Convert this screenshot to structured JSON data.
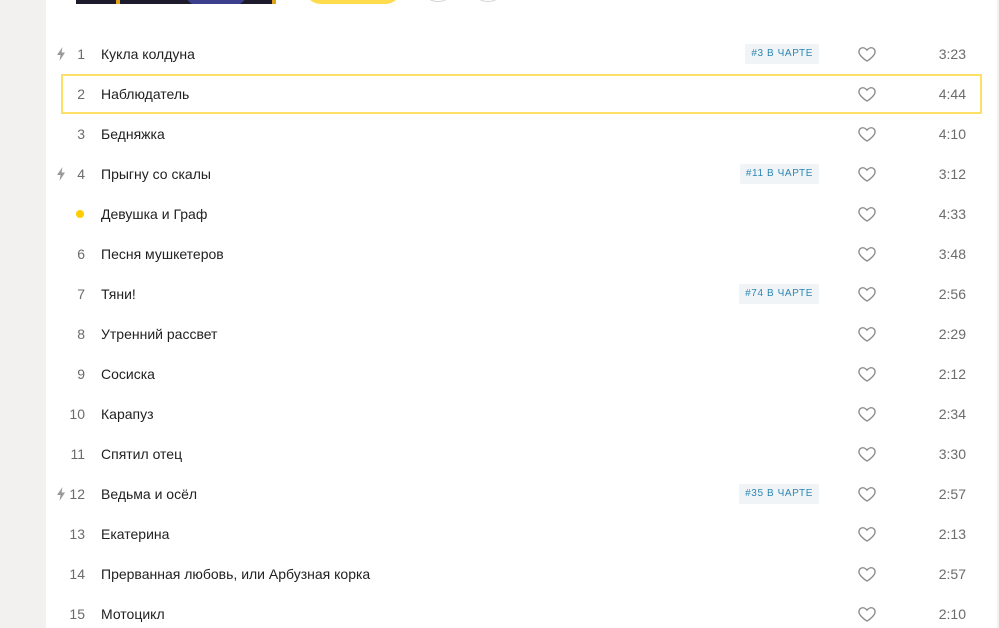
{
  "colors": {
    "accent": "#ffdb4d",
    "selection_border": "#ffe066",
    "playing_dot": "#ffcc00",
    "chart_badge_text": "#2c86b5",
    "chart_badge_bg": "#f0f4f6"
  },
  "tracks": [
    {
      "num": "1",
      "title": "Кукла колдуна",
      "chart": "#3 В ЧАРТЕ",
      "duration": "3:23",
      "bolt": true
    },
    {
      "num": "2",
      "title": "Наблюдатель",
      "chart": "",
      "duration": "4:44",
      "bolt": false,
      "selected": true
    },
    {
      "num": "3",
      "title": "Бедняжка",
      "chart": "",
      "duration": "4:10",
      "bolt": false
    },
    {
      "num": "4",
      "title": "Прыгну со скалы",
      "chart": "#11 В ЧАРТЕ",
      "duration": "3:12",
      "bolt": true
    },
    {
      "num": "",
      "title": "Девушка и Граф",
      "chart": "",
      "duration": "4:33",
      "bolt": false,
      "playing": true
    },
    {
      "num": "6",
      "title": "Песня мушкетеров",
      "chart": "",
      "duration": "3:48",
      "bolt": false
    },
    {
      "num": "7",
      "title": "Тяни!",
      "chart": "#74 В ЧАРТЕ",
      "duration": "2:56",
      "bolt": false
    },
    {
      "num": "8",
      "title": "Утренний рассвет",
      "chart": "",
      "duration": "2:29",
      "bolt": false
    },
    {
      "num": "9",
      "title": "Сосиска",
      "chart": "",
      "duration": "2:12",
      "bolt": false
    },
    {
      "num": "10",
      "title": "Карапуз",
      "chart": "",
      "duration": "2:34",
      "bolt": false
    },
    {
      "num": "11",
      "title": "Спятил отец",
      "chart": "",
      "duration": "3:30",
      "bolt": false
    },
    {
      "num": "12",
      "title": "Ведьма и осёл",
      "chart": "#35 В ЧАРТЕ",
      "duration": "2:57",
      "bolt": true
    },
    {
      "num": "13",
      "title": "Екатерина",
      "chart": "",
      "duration": "2:13",
      "bolt": false
    },
    {
      "num": "14",
      "title": "Прерванная любовь, или Арбузная корка",
      "chart": "",
      "duration": "2:57",
      "bolt": false
    },
    {
      "num": "15",
      "title": "Мотоцикл",
      "chart": "",
      "duration": "2:10",
      "bolt": false
    }
  ]
}
